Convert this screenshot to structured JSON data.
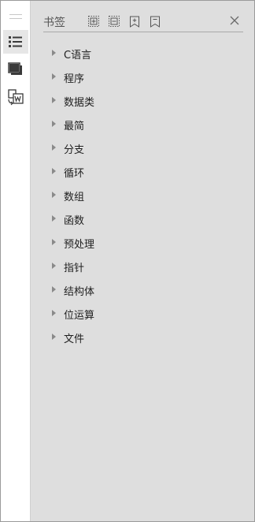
{
  "panel": {
    "title": "书签",
    "toolbar": [
      {
        "name": "expand-all-icon"
      },
      {
        "name": "collapse-all-icon"
      },
      {
        "name": "add-bookmark-icon"
      },
      {
        "name": "bookmark-icon"
      }
    ],
    "close_icon": "close-icon"
  },
  "rail": {
    "items": [
      {
        "name": "bookmark-list-icon",
        "active": true
      },
      {
        "name": "pages-icon",
        "active": false
      },
      {
        "name": "convert-to-word-icon",
        "active": false
      }
    ]
  },
  "bookmarks": [
    {
      "label": "C语言"
    },
    {
      "label": "程序"
    },
    {
      "label": "数据类"
    },
    {
      "label": "最简"
    },
    {
      "label": "分支"
    },
    {
      "label": "循环"
    },
    {
      "label": "数组"
    },
    {
      "label": "函数"
    },
    {
      "label": "预处理"
    },
    {
      "label": "指针"
    },
    {
      "label": "结构体"
    },
    {
      "label": "位运算"
    },
    {
      "label": "文件"
    }
  ]
}
